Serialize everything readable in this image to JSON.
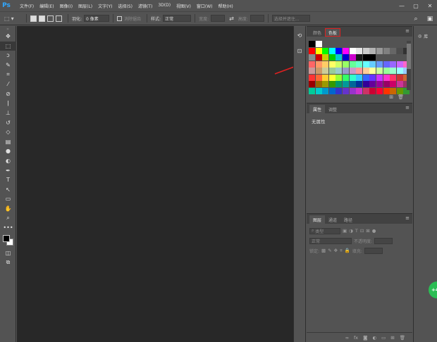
{
  "app": {
    "logo": "Ps"
  },
  "menu": [
    "文件(F)",
    "编辑(E)",
    "图像(I)",
    "图层(L)",
    "文字(Y)",
    "选择(S)",
    "滤镜(T)",
    "3D(D)",
    "视图(V)",
    "窗口(W)",
    "帮助(H)"
  ],
  "window_controls": {
    "minimize": "—",
    "maximize": "▢",
    "close": "✕"
  },
  "options": {
    "feather_label": "羽化:",
    "feather_value": "0 像素",
    "antialias_label": "消除锯齿",
    "style_label": "样式:",
    "style_value": "正常",
    "width_label": "宽度:",
    "height_label": "高度:",
    "select_mask_label": "选择并遮住..."
  },
  "panels": {
    "color_tab": "颜色",
    "swatches_tab": "色板",
    "properties_tab": "属性",
    "adjustments_tab": "调整",
    "no_properties": "无属性",
    "layers_tab": "图层",
    "channels_tab": "通道",
    "paths_tab": "路径",
    "kind_label": "类型",
    "blend_mode": "正常",
    "opacity_label": "不透明度:",
    "lock_label": "锁定:",
    "fill_label": "填充:"
  },
  "library": {
    "label": "库"
  },
  "swatches": {
    "colors": [
      [
        "#000000",
        "#ffffff"
      ],
      [
        "#ff0000",
        "#ffff00",
        "#00ff00",
        "#00ffff",
        "#0000ff",
        "#ff00ff",
        "#ffffff",
        "#e6e6e6",
        "#cccccc",
        "#b3b3b3",
        "#999999",
        "#808080",
        "#666666",
        "#4d4d4d",
        "#333333"
      ],
      [
        "#8c8c8c",
        "#cc0000",
        "#cccc00",
        "#00cc00",
        "#00cccc",
        "#0000cc",
        "#cc00cc",
        "#1a1a1a",
        "#000000",
        "#000000"
      ],
      [
        "#ff6666",
        "#ff9966",
        "#ffcc66",
        "#ffff66",
        "#ccff66",
        "#99ff66",
        "#66ff99",
        "#66ffcc",
        "#66ffff",
        "#66ccff",
        "#6699ff",
        "#6666ff",
        "#9966ff",
        "#cc66ff",
        "#ff66cc"
      ],
      [
        "#cc9999",
        "#cc9966",
        "#cccc99",
        "#99cc99",
        "#99cccc",
        "#9999cc",
        "#cc99cc",
        "#ff9999",
        "#ffcc99",
        "#ffff99",
        "#ccff99",
        "#99ff99",
        "#99ffcc",
        "#99ffff",
        "#99ccff"
      ],
      [
        "#ff3333",
        "#ff6633",
        "#ffcc33",
        "#ffff33",
        "#99ff33",
        "#33ff66",
        "#33ffcc",
        "#33ccff",
        "#3366ff",
        "#6633ff",
        "#cc33ff",
        "#ff33cc",
        "#ff3366",
        "#cc3333",
        "#cc6633"
      ],
      [
        "#990000",
        "#996600",
        "#999900",
        "#339900",
        "#009966",
        "#009999",
        "#006699",
        "#003399",
        "#330099",
        "#660099",
        "#990099",
        "#990066",
        "#cc0066",
        "#cc3399",
        "#993366"
      ],
      [
        "#00cc99",
        "#00cccc",
        "#0099cc",
        "#0066cc",
        "#3333cc",
        "#6633cc",
        "#9933cc",
        "#cc33cc",
        "#cc3366",
        "#cc0033",
        "#ff0033",
        "#ff3300",
        "#cc6600",
        "#669900",
        "#339933"
      ]
    ]
  },
  "icons": {
    "move": "✥",
    "marquee": "⬚",
    "lasso": "ↄ",
    "quick_select": "✎",
    "crop": "⌗",
    "eyedropper": "⁄",
    "heal": "⊘",
    "brush": "ǀ",
    "stamp": "⊥",
    "history_brush": "↺",
    "eraser": "◇",
    "gradient": "▤",
    "blur": "●",
    "dodge": "◐",
    "pen": "✒",
    "type": "T",
    "path_select": "↖",
    "shape": "▭",
    "hand": "✋",
    "zoom": "⌕",
    "more": "•••",
    "swap": "⇄",
    "quick_mask": "◫",
    "screen_mode": "⧉",
    "search": "⌕",
    "workspace": "▣",
    "panel_menu": "≡",
    "lib": "◎",
    "float": "+4"
  }
}
